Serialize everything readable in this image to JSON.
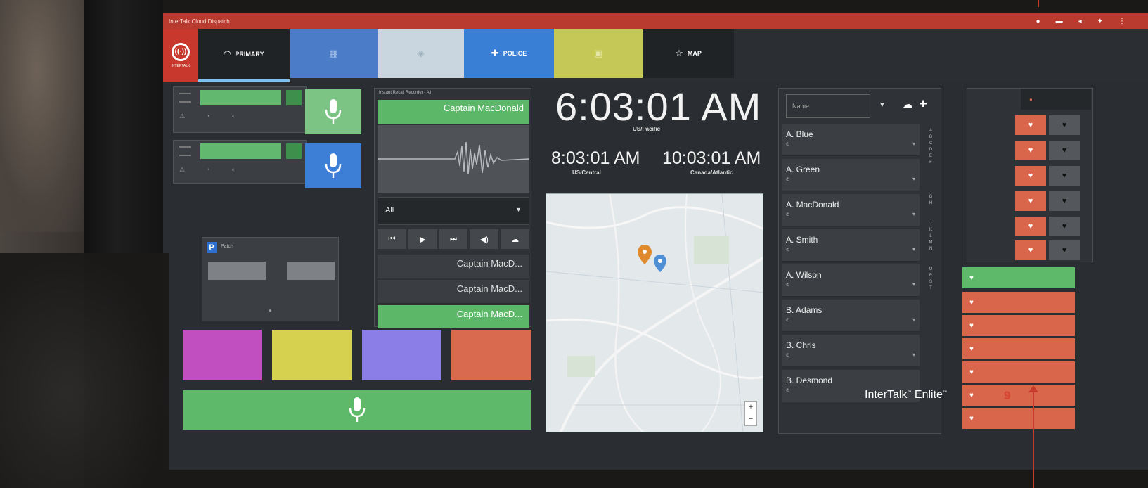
{
  "window": {
    "title": "InterTalk Cloud Dispatch"
  },
  "logo": {
    "sub": "INTERTALK"
  },
  "tabs": {
    "primary": "PRIMARY",
    "police": "POLICE",
    "map": "MAP"
  },
  "recorder": {
    "title": "Instant Recall Recorder - All",
    "top_name": "Captain MacDonald",
    "filter": "All",
    "calls": [
      {
        "name": "Captain MacD...",
        "selected": false
      },
      {
        "name": "Captain MacD...",
        "selected": false
      },
      {
        "name": "Captain MacD...",
        "selected": true
      }
    ]
  },
  "patch": {
    "label": "Patch"
  },
  "clocks": {
    "main": {
      "time": "6:03:01 AM",
      "zone": "US/Pacific"
    },
    "second": {
      "time": "8:03:01 AM",
      "zone": "US/Central"
    },
    "third": {
      "time": "10:03:01 AM",
      "zone": "Canada/Atlantic"
    }
  },
  "map": {
    "zoom_in": "+",
    "zoom_out": "−"
  },
  "contacts": {
    "search_placeholder": "Name",
    "items": [
      {
        "name": "A. Blue"
      },
      {
        "name": "A. Green"
      },
      {
        "name": "A. MacDonald"
      },
      {
        "name": "A. Smith"
      },
      {
        "name": "A. Wilson"
      },
      {
        "name": "B. Adams"
      },
      {
        "name": "B. Chris"
      },
      {
        "name": "B. Desmond"
      }
    ]
  },
  "overlay": {
    "brand": "InterTalk",
    "brand_tm1": "™",
    "brand_word2": " Enlite",
    "brand_tm2": "™",
    "page_number": "9"
  },
  "colors": {
    "accent_red": "#c53a2b",
    "green": "#5fb96a",
    "blue": "#3d7ed6",
    "unit_red": "#d9654b"
  }
}
